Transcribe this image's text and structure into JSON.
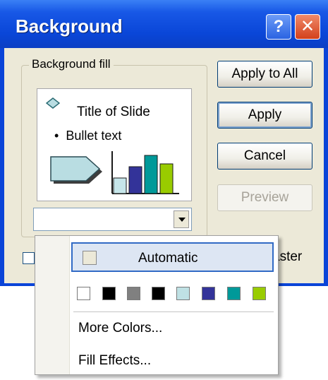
{
  "dialog": {
    "title": "Background",
    "help_symbol": "?",
    "close_symbol": "✕"
  },
  "group": {
    "label": "Background fill",
    "preview": {
      "title_text": "Title of Slide",
      "bullet_text": "Bullet text"
    }
  },
  "buttons": {
    "apply_all": "Apply to All",
    "apply": "Apply",
    "cancel": "Cancel",
    "preview": "Preview"
  },
  "checkbox": {
    "label_visible": "aster",
    "checked": false
  },
  "color_popup": {
    "automatic_label": "Automatic",
    "swatches": [
      "#ffffff",
      "#000000",
      "#808080",
      "#000000",
      "#bfe1e4",
      "#333399",
      "#009999",
      "#99cc00"
    ],
    "more_colors_label": "More Colors...",
    "fill_effects_label": "Fill Effects..."
  },
  "icons": {
    "preview_diamond": "diamond-icon",
    "preview_arrow": "arrow-shape-icon",
    "preview_chart": "bar-chart-icon",
    "dropdown": "chevron-down-icon"
  }
}
